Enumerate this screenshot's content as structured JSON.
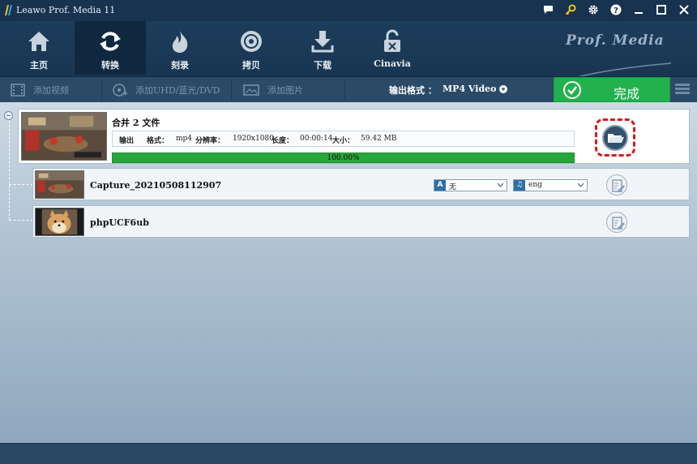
{
  "window": {
    "title": "Leawo Prof. Media 11",
    "controls": [
      "chat-icon",
      "key-icon",
      "gear-icon",
      "help-icon",
      "minimize-icon",
      "maximize-icon",
      "close-icon"
    ]
  },
  "nav": {
    "items": [
      {
        "label": "主页",
        "icon": "home-icon"
      },
      {
        "label": "转换",
        "icon": "convert-icon",
        "active": true
      },
      {
        "label": "刻录",
        "icon": "burn-icon"
      },
      {
        "label": "拷贝",
        "icon": "copy-disc-icon"
      },
      {
        "label": "下载",
        "icon": "download-icon"
      },
      {
        "label": "Cinavia",
        "icon": "cinavia-lock-icon"
      }
    ],
    "brand": "Prof. Media"
  },
  "toolbar": {
    "add_video": "添加视频",
    "add_uhd": "添加UHD/蓝光/DVD",
    "add_photo": "添加图片",
    "format_label": "输出格式 ：",
    "format_value": "MP4 Video",
    "done_label": "完成"
  },
  "merged": {
    "title": "合并 2 文件",
    "output_label": "输出",
    "format_key": "格式：",
    "format_val": "mp4",
    "resolution_key": "分辨率：",
    "resolution_val": "1920x1080",
    "length_key": "长度：",
    "length_val": "00:00:14",
    "size_key": "大小：",
    "size_val": "59.42 MB",
    "progress": 100,
    "progress_text": "100.00%"
  },
  "files": [
    {
      "name": "Capture_20210508112907",
      "subtitle_value": "无",
      "audio_value": "eng",
      "subtitle_badge": "A",
      "audio_badge": "♫"
    },
    {
      "name": "phpUCF6ub"
    }
  ],
  "colors": {
    "title_bar": "#18334f",
    "nav_bg": "#1d3d5c",
    "done_green": "#22b14c",
    "progress_green": "#27a73a",
    "highlight_red": "#d41b1b"
  }
}
